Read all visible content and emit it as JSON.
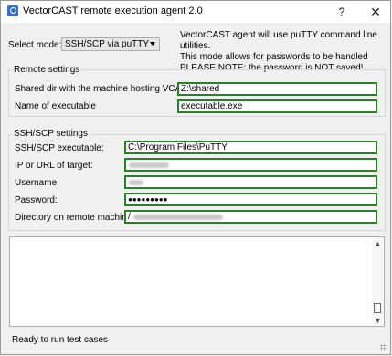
{
  "window": {
    "title": "VectorCAST remote execution agent 2.0",
    "help": "?",
    "close": "✕"
  },
  "mode": {
    "label": "Select mode:",
    "selected": "SSH/SCP via puTTY"
  },
  "info": {
    "line1": "VectorCAST agent will use puTTY command line utilities.",
    "line2": "This mode allows for passwords to be handled",
    "line3": "PLEASE NOTE: the password is NOT saved!"
  },
  "remote": {
    "title": "Remote settings",
    "shared_label": "Shared dir with the machine hosting VCAST",
    "shared_value": "Z:\\shared",
    "exe_label": "Name of executable",
    "exe_value": "executable.exe"
  },
  "ssh": {
    "title": "SSH/SCP settings",
    "exe_label": "SSH/SCP executable:",
    "exe_value": "C:\\Program Files\\PuTTY",
    "ip_label": "IP or URL of target:",
    "user_label": "Username:",
    "pass_label": "Password:",
    "pass_value": "●●●●●●●●●",
    "dir_label": "Directory on remote machine",
    "dir_value": "/"
  },
  "log": {
    "up": "▲",
    "down": "▼"
  },
  "status": "Ready to run test cases"
}
